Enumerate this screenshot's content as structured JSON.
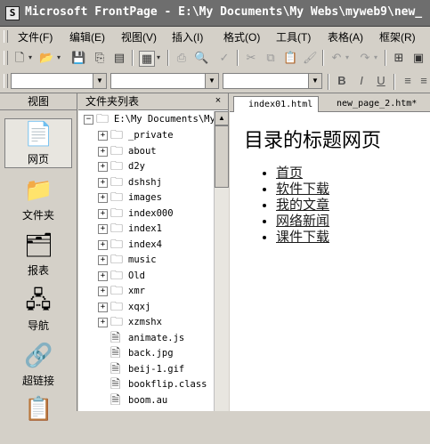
{
  "window": {
    "title": "Microsoft FrontPage - E:\\My Documents\\My Webs\\myweb9\\new_",
    "app_icon_glyph": "S"
  },
  "menu": {
    "items": [
      {
        "label": "文件(F)"
      },
      {
        "label": "编辑(E)"
      },
      {
        "label": "视图(V)"
      },
      {
        "label": "插入(I)"
      },
      {
        "label": "格式(O)"
      },
      {
        "label": "工具(T)"
      },
      {
        "label": "表格(A)"
      },
      {
        "label": "框架(R)"
      }
    ]
  },
  "toolbar": {
    "bold": "B",
    "italic": "I",
    "underline": "U"
  },
  "views": {
    "header": "视图",
    "items": [
      {
        "label": "网页",
        "icon": "page-icon"
      },
      {
        "label": "文件夹",
        "icon": "folder-icon"
      },
      {
        "label": "报表",
        "icon": "report-icon"
      },
      {
        "label": "导航",
        "icon": "navigation-icon"
      },
      {
        "label": "超链接",
        "icon": "hyperlink-icon"
      }
    ]
  },
  "folder_list": {
    "header": "文件夹列表",
    "close": "×",
    "root": "E:\\My Documents\\My",
    "folders": [
      "_private",
      "about",
      "d2y",
      "dshshj",
      "images",
      "index000",
      "index1",
      "index4",
      "music",
      "Old",
      "xmr",
      "xqxj",
      "xzmshx"
    ],
    "files": [
      "animate.js",
      "back.jpg",
      "beij-1.gif",
      "bookflip.class",
      "boom.au"
    ]
  },
  "editor": {
    "tabs": [
      {
        "label": "index01.html"
      },
      {
        "label": "new_page_2.htm*"
      }
    ],
    "heading": "目录的标题网页",
    "links": [
      "首页",
      "软件下载",
      "我的文章",
      "网络新闻",
      "课件下载"
    ]
  }
}
